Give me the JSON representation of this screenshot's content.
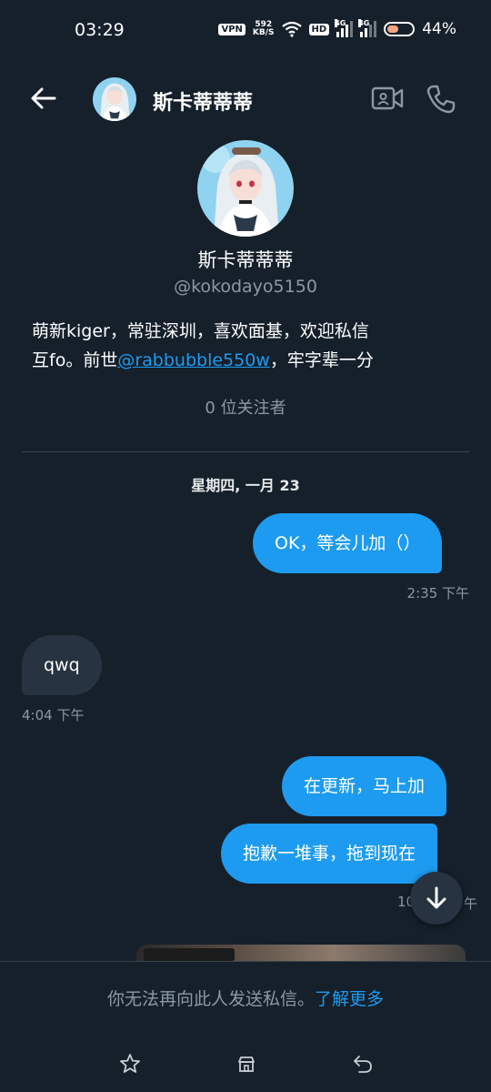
{
  "status_bar": {
    "time": "03:29",
    "vpn": "VPN",
    "speed_value": "592",
    "speed_unit": "KB/S",
    "hd_badge": "HD",
    "net1": "4G",
    "net2": "4G",
    "battery": "44%"
  },
  "header": {
    "name": "斯卡蒂蒂蒂",
    "icons": [
      "back-arrow-icon",
      "video-call-icon",
      "phone-icon"
    ]
  },
  "profile": {
    "name": "斯卡蒂蒂蒂",
    "handle": "@kokodayo5150",
    "bio_line1": "萌新kiger，常驻深圳，喜欢面基，欢迎私信",
    "bio_line2_prefix": "互fo。前世",
    "bio_link": "@rabbubble550w",
    "bio_line2_suffix": "，牢字辈一分",
    "followers": "0 位关注者"
  },
  "conversation": {
    "date": "星期四, 一月 23",
    "messages": [
      {
        "text": "OK，等会儿加（）",
        "direction": "out",
        "time": "2:35 下午"
      },
      {
        "text": "qwq",
        "direction": "in",
        "time": "4:04 下午"
      },
      {
        "text": "在更新，马上加",
        "direction": "out"
      },
      {
        "text": "抱歉一堆事，拖到现在",
        "direction": "out",
        "time": "10"
      }
    ],
    "trailing_time_suffix": "午"
  },
  "notice": {
    "text": "你无法再向此人发送私信。",
    "link": "了解更多"
  },
  "nav_icons": [
    "star-icon",
    "shop-icon",
    "back-gesture-icon"
  ],
  "colors": {
    "background": "#15202b",
    "accent": "#1d9bf0",
    "incoming_bubble": "#273340",
    "muted_text": "#8b98a5"
  }
}
